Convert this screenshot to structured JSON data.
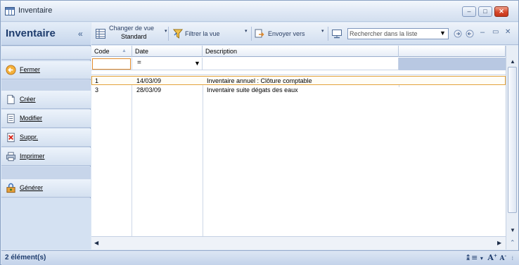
{
  "window": {
    "title": "Inventaire"
  },
  "title_buttons": {
    "minimize": "–",
    "maximize": "□",
    "close": "✕"
  },
  "left_pane": {
    "title": "Inventaire",
    "collapse_glyph": "«",
    "buttons": {
      "close": "Fermer",
      "create": "Créer",
      "modify": "Modifier",
      "delete": "Suppr.",
      "print": "Imprimer",
      "generate": "Générer"
    }
  },
  "toolbar": {
    "view_label_1": "Changer de vue",
    "view_label_2": "Standard",
    "filter": "Filtrer la vue",
    "send": "Envoyer vers",
    "search_placeholder": "Rechercher dans la liste",
    "dropdown_glyph": "▼"
  },
  "grid": {
    "columns": [
      "Code",
      "Date",
      "Description"
    ],
    "filter_operator": "=",
    "rows": [
      {
        "code": "1",
        "date": "14/03/09",
        "description": "Inventaire annuel : Clôture comptable"
      },
      {
        "code": "3",
        "date": "28/03/09",
        "description": "Inventaire suite dégats des eaux"
      }
    ]
  },
  "status": {
    "count": "2 élément(s)"
  },
  "colors": {
    "selection_border": "#e3a33b",
    "pane_title": "#1e3c6d"
  }
}
